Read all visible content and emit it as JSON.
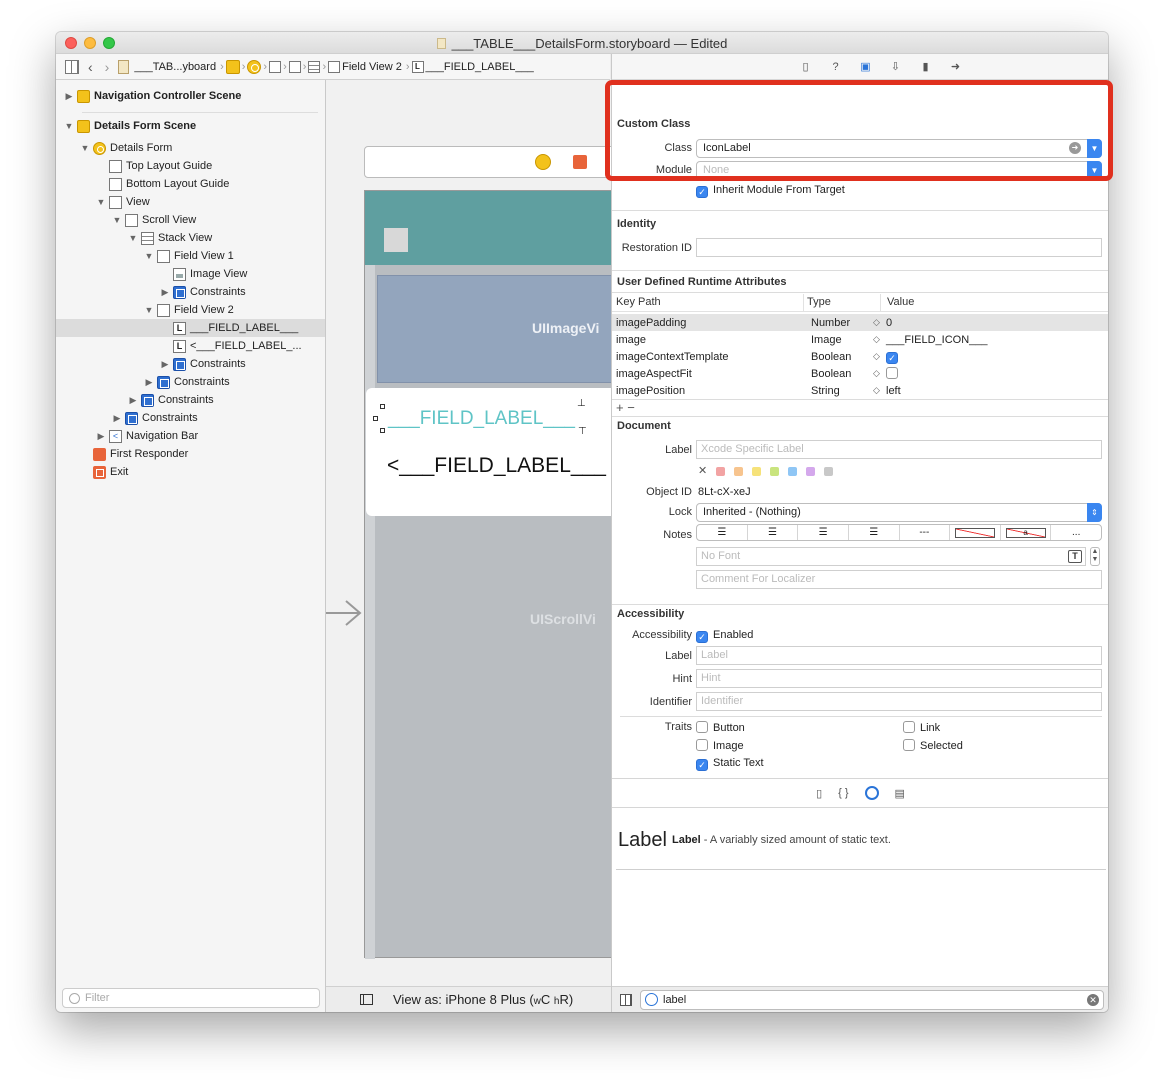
{
  "window": {
    "title": "___TABLE___DetailsForm.storyboard — Edited"
  },
  "jumpbar": {
    "storyboard": "___TAB...yboard",
    "field_view": "Field View 2",
    "field_label": "___FIELD_LABEL___"
  },
  "navigator": {
    "items": [
      {
        "label": "Navigation Controller Scene"
      },
      {
        "label": "Details Form Scene"
      },
      {
        "label": "Details Form"
      },
      {
        "label": "Top Layout Guide"
      },
      {
        "label": "Bottom Layout Guide"
      },
      {
        "label": "View"
      },
      {
        "label": "Scroll View"
      },
      {
        "label": "Stack View"
      },
      {
        "label": "Field View 1"
      },
      {
        "label": "Image View"
      },
      {
        "label": "Constraints"
      },
      {
        "label": "Field View 2"
      },
      {
        "label": "___FIELD_LABEL___"
      },
      {
        "label": "<___FIELD_LABEL_..."
      },
      {
        "label": "Constraints"
      },
      {
        "label": "Constraints"
      },
      {
        "label": "Constraints"
      },
      {
        "label": "Constraints"
      },
      {
        "label": "Navigation Bar"
      },
      {
        "label": "First Responder"
      },
      {
        "label": "Exit"
      }
    ],
    "filter_placeholder": "Filter"
  },
  "canvas": {
    "image_view_label": "UIImageVi",
    "field_label_1": "___FIELD_LABEL___",
    "field_label_2": "<___FIELD_LABEL___",
    "scroll_view_label": "UIScrollVi",
    "view_as": "View as: iPhone 8 Plus (",
    "size_w": "w",
    "size_c": "C",
    "size_h": "h",
    "size_r": "R",
    "paren_close": ")"
  },
  "inspector": {
    "custom_class": {
      "heading": "Custom Class",
      "class_label": "Class",
      "class_value": "IconLabel",
      "module_label": "Module",
      "module_placeholder": "None",
      "inherit_label": "Inherit Module From Target",
      "inherit_checked": true
    },
    "identity": {
      "heading": "Identity",
      "restoration_label": "Restoration ID",
      "restoration_value": ""
    },
    "runtime_attributes": {
      "heading": "User Defined Runtime Attributes",
      "columns": [
        "Key Path",
        "Type",
        "Value"
      ],
      "rows": [
        {
          "key_path": "imagePadding",
          "type": "Number",
          "value": "0"
        },
        {
          "key_path": "image",
          "type": "Image",
          "value": "___FIELD_ICON___"
        },
        {
          "key_path": "imageContextTemplate",
          "type": "Boolean",
          "value": ""
        },
        {
          "key_path": "imageAspectFit",
          "type": "Boolean",
          "value": ""
        },
        {
          "key_path": "imagePosition",
          "type": "String",
          "value": "left"
        }
      ],
      "add_remove": "+ −"
    },
    "document": {
      "heading": "Document",
      "label_label": "Label",
      "label_placeholder": "Xcode Specific Label",
      "label_colors": [
        "#f2a3a3",
        "#f7c48e",
        "#f6e27a",
        "#c9e47e",
        "#8fc6f5",
        "#d4a8ec",
        "#c8c8c8"
      ],
      "object_id_label": "Object ID",
      "object_id_value": "8Lt-cX-xeJ",
      "lock_label": "Lock",
      "lock_value": "Inherited - (Nothing)",
      "notes_label": "Notes",
      "notes_more": "...",
      "notes_sample": "a",
      "font_placeholder": "No Font",
      "comment_placeholder": "Comment For Localizer"
    },
    "accessibility": {
      "heading": "Accessibility",
      "accessibility_label": "Accessibility",
      "enabled_label": "Enabled",
      "label_label": "Label",
      "label_placeholder": "Label",
      "hint_label": "Hint",
      "hint_placeholder": "Hint",
      "identifier_label": "Identifier",
      "identifier_placeholder": "Identifier",
      "traits_label": "Traits",
      "traits": [
        {
          "label": "Button",
          "checked": false
        },
        {
          "label": "Link",
          "checked": false
        },
        {
          "label": "Image",
          "checked": false
        },
        {
          "label": "Selected",
          "checked": false
        },
        {
          "label": "Static Text",
          "checked": true
        }
      ]
    },
    "library": {
      "item_title": "Label",
      "item_name": "Label",
      "item_desc": " - A variably sized amount of static text.",
      "search_value": "label"
    }
  }
}
